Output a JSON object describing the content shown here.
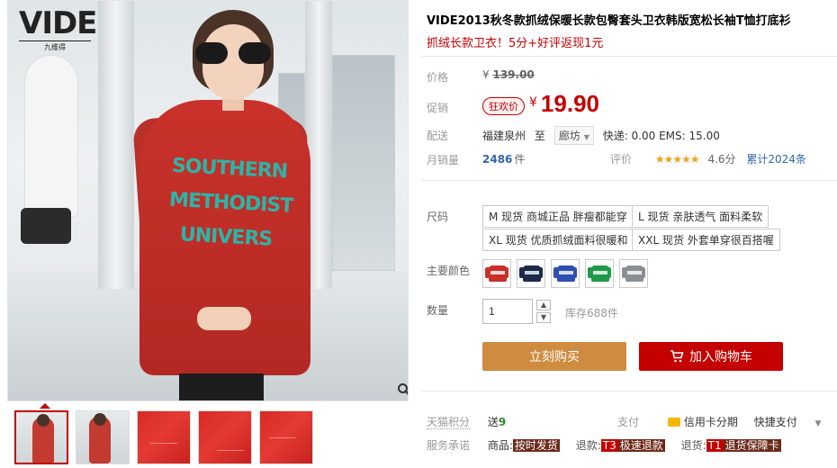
{
  "brand": {
    "logo_text": "VIDE",
    "logo_sub": "九维得"
  },
  "product": {
    "title": "VIDE2013秋冬款抓绒保暖长款包臀套头卫衣韩版宽松长袖T恤打底衫",
    "subtitle": "抓绒长款卫衣！5分+好评返现1元",
    "print_lines": [
      "SOUTHERN",
      "METHODIST",
      "UNIVERS"
    ]
  },
  "price": {
    "label": "价格",
    "original": "139.00",
    "currency": "¥",
    "promo_label": "促销",
    "promo_badge": "狂欢价",
    "promo": "19.90"
  },
  "shipping": {
    "label": "配送",
    "from": "福建泉州",
    "to_word": "至",
    "destination": "廊坊",
    "fee": "快递: 0.00 EMS: 15.00"
  },
  "sales": {
    "label": "月销量",
    "count": "2486",
    "unit": "件",
    "review_label": "评价",
    "stars": "★★★★★",
    "score": "4.6分",
    "total": "累计2024条"
  },
  "sku": {
    "label": "尺码",
    "options": [
      "M 现货 商城正品 胖瘦都能穿",
      "L 现货 亲肤透气 面料柔软",
      "XL 现货 优质抓绒面料很暖和",
      "XXL 现货 外套单穿很百搭喔"
    ]
  },
  "colors": {
    "label": "主要颜色",
    "swatches": [
      {
        "name": "red",
        "color": "#c9302a"
      },
      {
        "name": "navy",
        "color": "#1d2a4a"
      },
      {
        "name": "blue",
        "color": "#2f4fb0"
      },
      {
        "name": "green",
        "color": "#1f9a4a"
      },
      {
        "name": "gray",
        "color": "#8a8f96"
      }
    ]
  },
  "quantity": {
    "label": "数量",
    "value": "1",
    "stock": "库存688件"
  },
  "actions": {
    "buy": "立刻购买",
    "cart": "加入购物车"
  },
  "service": {
    "points_label": "天猫积分",
    "points_text": "送",
    "points_value": "9",
    "pay_label": "支付",
    "pay_card": "信用卡分期",
    "pay_fast": "快捷支付",
    "promise_label": "服务承诺",
    "goods_k": "商品:",
    "goods_tag": "按时发货",
    "refund_k": "退款:",
    "refund_tag_code": "T3",
    "refund_tag": "极速退款",
    "return_k": "退货:",
    "return_tag_code": "T1",
    "return_tag": "退货保障卡"
  }
}
